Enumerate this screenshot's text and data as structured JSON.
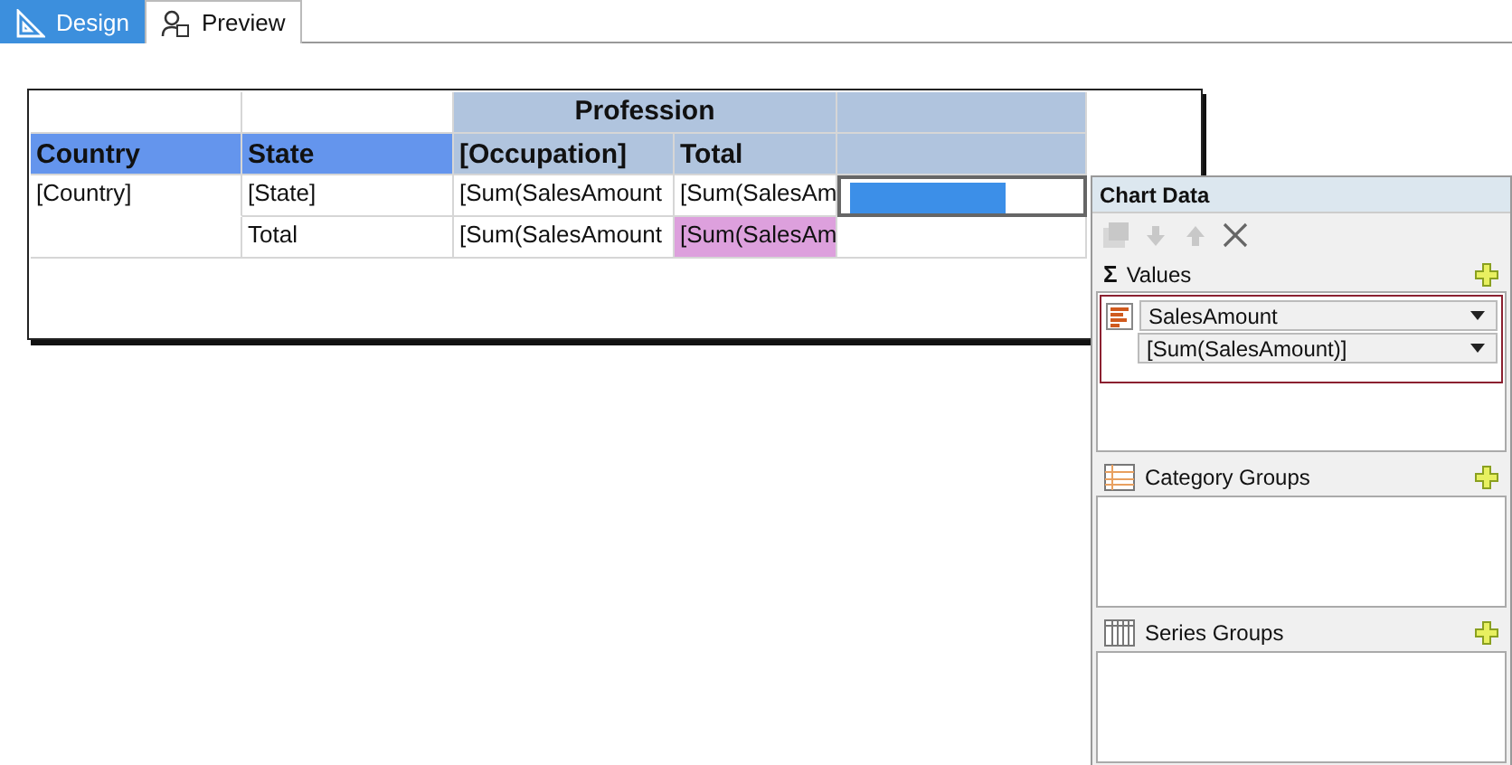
{
  "tabs": [
    {
      "label": "Design",
      "kind": "design",
      "selected": true
    },
    {
      "label": "Preview",
      "kind": "preview",
      "selected": false
    }
  ],
  "table": {
    "group_header": "Profession",
    "columns": [
      "Country",
      "State",
      "[Occupation]",
      "Total"
    ],
    "rows": [
      {
        "cells": [
          {
            "text": "[Country]",
            "highlighted": false
          },
          {
            "text": "[State]",
            "highlighted": false
          },
          {
            "text": "[Sum(SalesAmount",
            "highlighted": false
          },
          {
            "text": "[Sum(SalesAm",
            "highlighted": false
          }
        ],
        "chart": {
          "selected": true
        }
      },
      {
        "cells": [
          {
            "text": "",
            "highlighted": false
          },
          {
            "text": "Total",
            "highlighted": false
          },
          {
            "text": "[Sum(SalesAmount",
            "highlighted": false
          },
          {
            "text": "[Sum(SalesAm",
            "highlighted": true
          }
        ]
      }
    ]
  },
  "chart_data_panel": {
    "title": "Chart Data",
    "toolbar": [
      {
        "kind": "properties",
        "disabled": true
      },
      {
        "kind": "down",
        "disabled": true
      },
      {
        "kind": "up",
        "disabled": true
      },
      {
        "kind": "delete",
        "disabled": false
      }
    ],
    "sections": [
      {
        "kind": "values",
        "symbol": "Σ",
        "title": "Values",
        "items": [
          {
            "field": "SalesAmount",
            "expression": "[Sum(SalesAmount)]"
          }
        ]
      },
      {
        "kind": "category",
        "title": "Category Groups"
      },
      {
        "kind": "series",
        "title": "Series Groups"
      }
    ]
  }
}
